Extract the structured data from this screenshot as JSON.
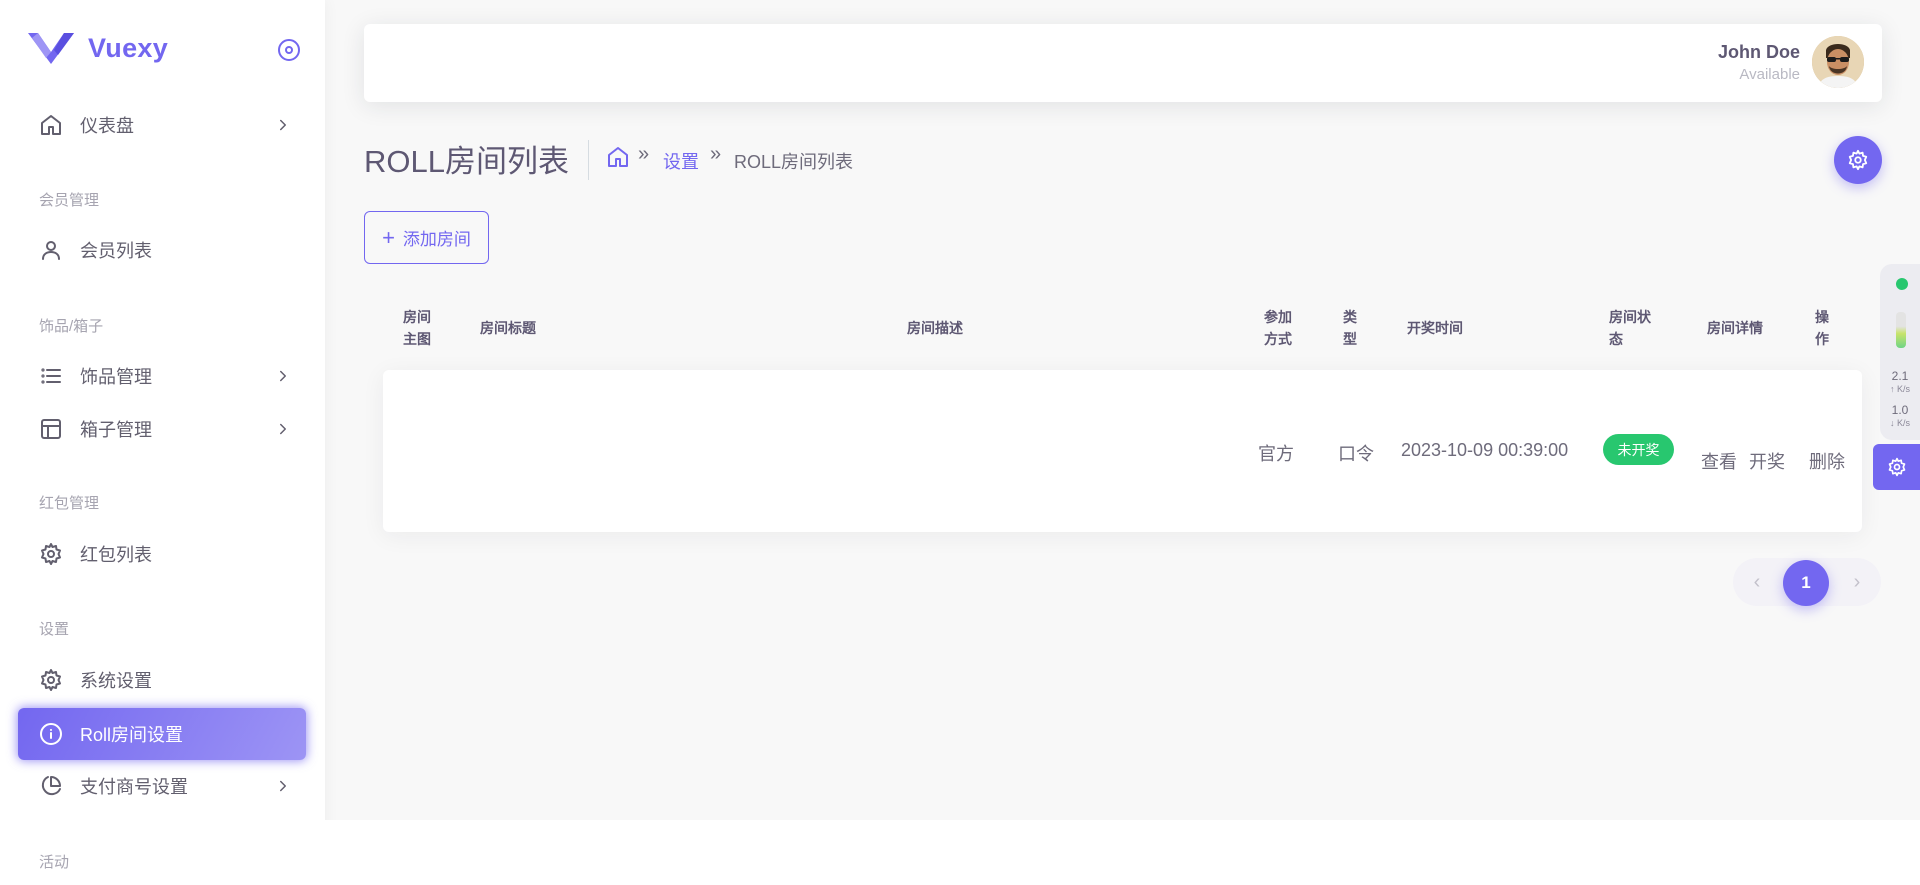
{
  "brand": {
    "name": "Vuexy",
    "color": "#7367f0"
  },
  "sidebar": {
    "items": [
      {
        "label": "仪表盘",
        "icon": "home-icon",
        "has_children": true
      },
      {
        "label": "会员列表",
        "icon": "user-icon",
        "has_children": false
      },
      {
        "label": "饰品管理",
        "icon": "list-icon",
        "has_children": true
      },
      {
        "label": "箱子管理",
        "icon": "layout-icon",
        "has_children": true
      },
      {
        "label": "红包列表",
        "icon": "gear-icon",
        "has_children": false
      },
      {
        "label": "系统设置",
        "icon": "gear-icon",
        "has_children": false
      },
      {
        "label": "Roll房间设置",
        "icon": "info-icon",
        "has_children": false,
        "active": true
      },
      {
        "label": "支付商号设置",
        "icon": "pie-chart-icon",
        "has_children": true
      }
    ],
    "headers": [
      "会员管理",
      "饰品/箱子",
      "红包管理",
      "设置",
      "活动"
    ]
  },
  "user": {
    "name": "John Doe",
    "status": "Available"
  },
  "page": {
    "title": "ROLL房间列表"
  },
  "breadcrumb": {
    "sep": "»",
    "link": "设置",
    "current": "ROLL房间列表"
  },
  "toolbar": {
    "add_label": "添加房间"
  },
  "table": {
    "columns": [
      "房间\n主图",
      "房间标题",
      "房间描述",
      "参加\n方式",
      "类\n型",
      "开奖时间",
      "房间状\n态",
      "房间详情",
      "操\n作"
    ],
    "rows": [
      {
        "join_method": "官方",
        "type": "口令",
        "draw_time": "2023-10-09 00:39:00",
        "status": "未开奖",
        "status_color": "#28c76f",
        "actions": {
          "view": "查看",
          "draw": "开奖",
          "delete": "删除"
        }
      }
    ]
  },
  "pagination": {
    "current": "1",
    "prev": "‹",
    "next": "›"
  },
  "net_widget": {
    "up_value": "2.1",
    "up_unit": "↑ K/s",
    "down_value": "1.0",
    "down_unit": "↓ K/s"
  }
}
